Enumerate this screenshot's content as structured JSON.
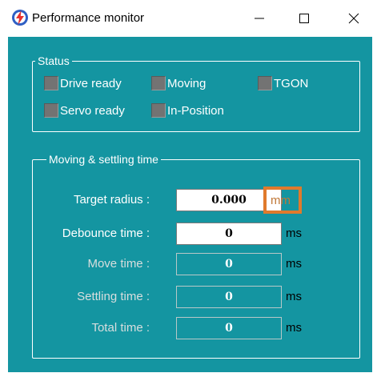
{
  "window": {
    "title": "Performance monitor",
    "icon": "lightning-bolt-app-icon",
    "controls": {
      "minimize": "minimize-icon",
      "maximize": "maximize-icon",
      "close": "close-icon"
    }
  },
  "colors": {
    "teal": "#1495a1",
    "highlight": "#e07a2c",
    "led_off": "#737373"
  },
  "status": {
    "title": "Status",
    "indicators": [
      {
        "label": "Drive ready",
        "state": "off"
      },
      {
        "label": "Moving",
        "state": "off"
      },
      {
        "label": "TGON",
        "state": "off"
      },
      {
        "label": "Servo ready",
        "state": "off"
      },
      {
        "label": "In-Position",
        "state": "off"
      }
    ]
  },
  "moving": {
    "title": "Moving & settling time",
    "rows": [
      {
        "label": "Target radius :",
        "value": "0.000",
        "unit": "mm",
        "editable": true
      },
      {
        "label": "Debounce time :",
        "value": "0",
        "unit": "ms",
        "editable": true
      },
      {
        "label": "Move time :",
        "value": "0",
        "unit": "ms",
        "editable": false
      },
      {
        "label": "Settling time :",
        "value": "0",
        "unit": "ms",
        "editable": false
      },
      {
        "label": "Total time :",
        "value": "0",
        "unit": "ms",
        "editable": false
      }
    ]
  }
}
